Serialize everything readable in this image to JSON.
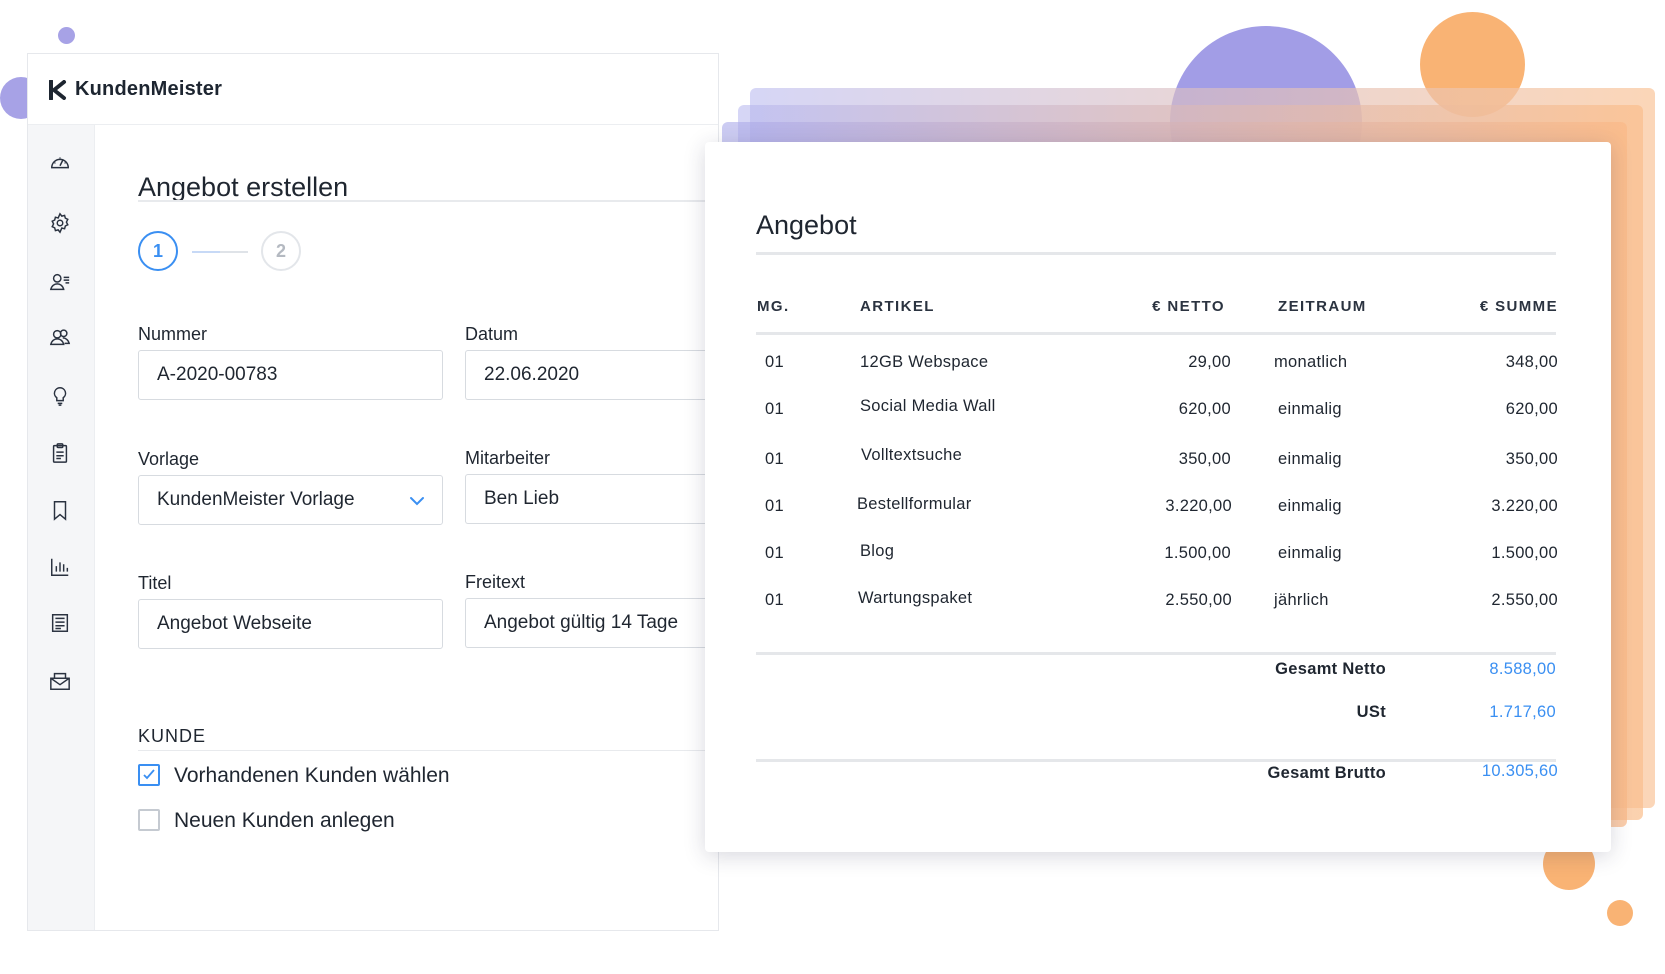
{
  "brand": {
    "name": "KundenMeister"
  },
  "form": {
    "title": "Angebot erstellen",
    "steps": [
      "1",
      "2"
    ],
    "nummer": {
      "label": "Nummer",
      "value": "A-2020-00783"
    },
    "datum": {
      "label": "Datum",
      "value": "22.06.2020"
    },
    "vorlage": {
      "label": "Vorlage",
      "value": "KundenMeister Vorlage"
    },
    "mitarbeiter": {
      "label": "Mitarbeiter",
      "value": "Ben Lieb"
    },
    "titel": {
      "label": "Titel",
      "value": "Angebot Webseite"
    },
    "freitext": {
      "label": "Freitext",
      "value": "Angebot gültig 14 Tage"
    },
    "kunde": {
      "section": "KUNDE",
      "options": [
        {
          "label": "Vorhandenen Kunden wählen",
          "checked": true
        },
        {
          "label": "Neuen Kunden anlegen",
          "checked": false
        }
      ]
    }
  },
  "sidebar_icons": [
    "dashboard-icon",
    "settings-icon",
    "contacts-icon",
    "customers-icon",
    "ideas-icon",
    "clipboard-icon",
    "bookmark-icon",
    "reports-icon",
    "document-list-icon",
    "mail-icon"
  ],
  "invoice": {
    "title": "Angebot",
    "headers": {
      "qty": "MG.",
      "item": "ARTIKEL",
      "net": "€ NETTO",
      "period": "ZEITRAUM",
      "sum": "€ SUMME"
    },
    "rows": [
      {
        "qty": "01",
        "item": "12GB Webspace",
        "net": "29,00",
        "period": "monatlich",
        "sum": "348,00"
      },
      {
        "qty": "01",
        "item": "Social Media Wall",
        "net": "620,00",
        "period": "einmalig",
        "sum": "620,00"
      },
      {
        "qty": "01",
        "item": "Volltextsuche",
        "net": "350,00",
        "period": "einmalig",
        "sum": "350,00"
      },
      {
        "qty": "01",
        "item": "Bestellformular",
        "net": "3.220,00",
        "period": "einmalig",
        "sum": "3.220,00"
      },
      {
        "qty": "01",
        "item": "Blog",
        "net": "1.500,00",
        "period": "einmalig",
        "sum": "1.500,00"
      },
      {
        "qty": "01",
        "item": "Wartungspaket",
        "net": "2.550,00",
        "period": "jährlich",
        "sum": "2.550,00"
      }
    ],
    "totals": {
      "netto_label": "Gesamt Netto",
      "netto": "8.588,00",
      "ust_label": "USt",
      "ust": "1.717,60",
      "brutto_label": "Gesamt Brutto",
      "brutto": "10.305,60"
    }
  },
  "colors": {
    "accent": "#3a8ff2",
    "purple": "#a29de6",
    "orange": "#f9b374"
  }
}
